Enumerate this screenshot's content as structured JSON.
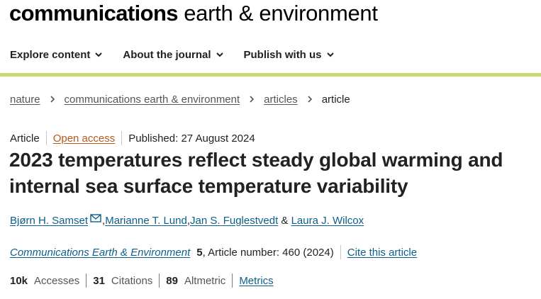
{
  "header": {
    "journal_bold": "communications",
    "journal_light": " earth & environment"
  },
  "nav": {
    "items": [
      {
        "label": "Explore content",
        "icon": "chevron-down-icon"
      },
      {
        "label": "About the journal",
        "icon": "chevron-down-icon"
      },
      {
        "label": "Publish with us",
        "icon": "chevron-down-icon"
      }
    ]
  },
  "colors": {
    "accent_bar": "#c8d96f",
    "link": "#0b5f8a",
    "open_access": "#b45a1e",
    "text": "#222222"
  },
  "breadcrumb": {
    "items": [
      "nature",
      "communications earth & environment",
      "articles"
    ],
    "current": "article"
  },
  "article": {
    "type": "Article",
    "access": "Open access",
    "published": "Published: 27 August 2024",
    "title": "2023 temperatures reflect steady global warming and internal sea surface temperature variability",
    "authors": [
      "Bjørn H. Samset",
      "Marianne T. Lund",
      "Jan S. Fuglestvedt",
      "Laura J. Wilcox"
    ],
    "author_separators": [
      ", ",
      ", ",
      " & "
    ],
    "journal": "Communications Earth & Environment",
    "volume": "5",
    "article_number": ", Article number: 460 (2024)",
    "cite_label": "Cite this article"
  },
  "metrics": {
    "accesses_value": "10k",
    "accesses_label": "Accesses",
    "citations_value": "31",
    "citations_label": "Citations",
    "altmetric_value": "89",
    "altmetric_label": "Altmetric",
    "metrics_link": "Metrics"
  }
}
